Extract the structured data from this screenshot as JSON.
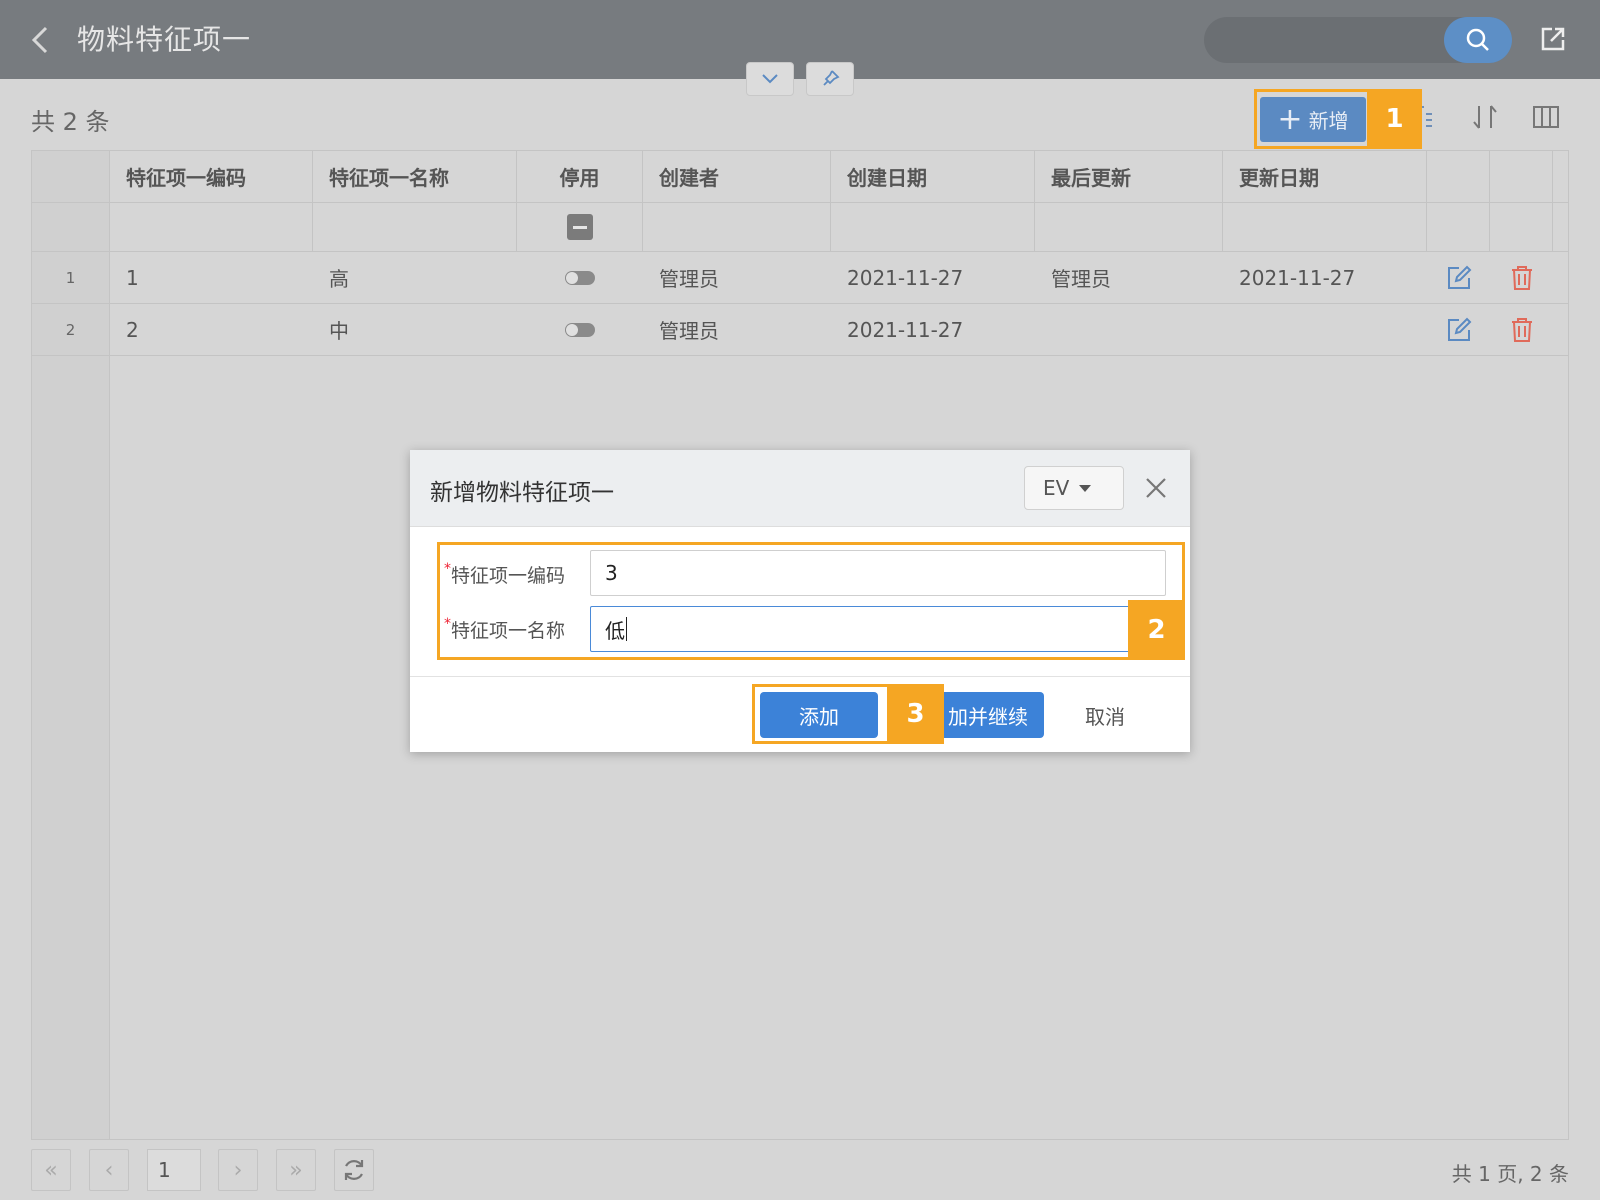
{
  "header": {
    "title": "物料特征项一"
  },
  "toolbar": {
    "count_text": "共 2 条",
    "add_label": "新增"
  },
  "table": {
    "columns": [
      "特征项一编码",
      "特征项一名称",
      "停用",
      "创建者",
      "创建日期",
      "最后更新",
      "更新日期"
    ],
    "rows": [
      {
        "num": "1",
        "code": "1",
        "name": "高",
        "creator": "管理员",
        "created": "2021-11-27",
        "updater": "管理员",
        "updated": "2021-11-27"
      },
      {
        "num": "2",
        "code": "2",
        "name": "中",
        "creator": "管理员",
        "created": "2021-11-27",
        "updater": "",
        "updated": ""
      }
    ]
  },
  "pagination": {
    "page": "1",
    "summary": "共 1 页, 2 条"
  },
  "dialog": {
    "title": "新增物料特征项一",
    "language": "EV",
    "fields": [
      {
        "label": "特征项一编码",
        "required_mark": "*",
        "value": "3"
      },
      {
        "label": "特征项一名称",
        "required_mark": "*",
        "value": "低"
      }
    ],
    "add_label": "添加",
    "add_continue_label": "加并继续",
    "cancel_label": "取消"
  },
  "annotations": [
    "1",
    "2",
    "3"
  ],
  "colors": {
    "accent": "#3c82d8",
    "highlight": "#f5a623",
    "delete": "#e06a5a"
  }
}
